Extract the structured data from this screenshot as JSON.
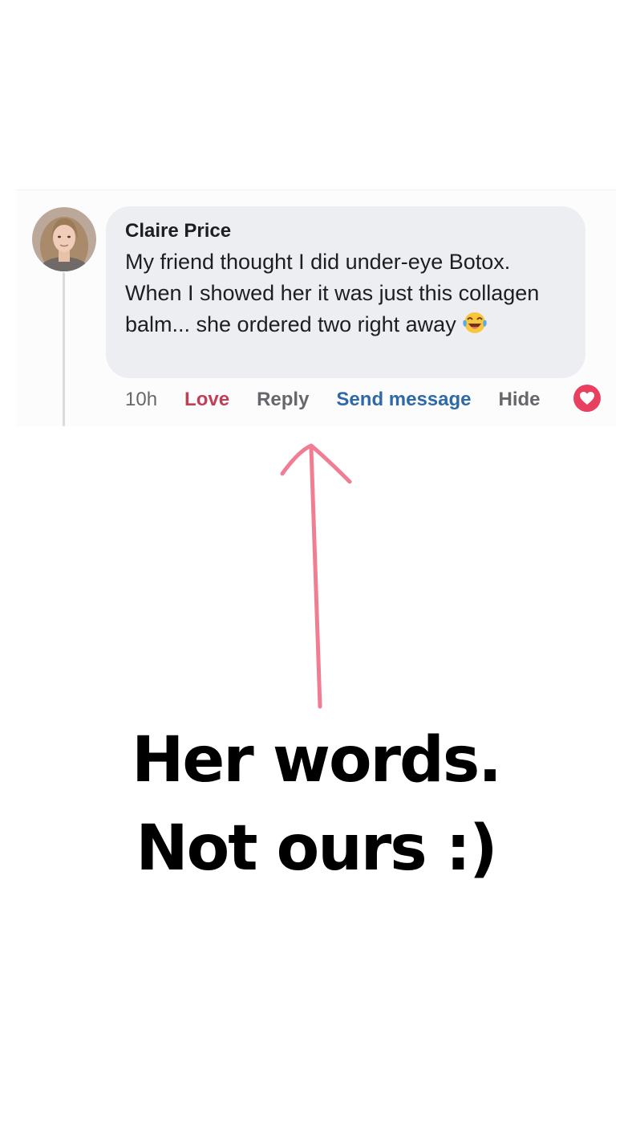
{
  "comment": {
    "author": "Claire Price",
    "text": "My friend thought I did under-eye Botox. When I showed her it was just this collagen balm... she ordered two right away",
    "emoji": "laughing-with-tears-emoji",
    "time": "10h",
    "actions": {
      "love": "Love",
      "reply": "Reply",
      "send_message": "Send message",
      "hide": "Hide"
    },
    "reaction_icon": "heart-icon"
  },
  "caption": {
    "line1": "Her words.",
    "line2": "Not ours :)"
  },
  "colors": {
    "bubble": "#eceef2",
    "love": "#c23e57",
    "send_message": "#2f6aa8",
    "heart": "#e8405e",
    "arrow": "#f07d92"
  }
}
